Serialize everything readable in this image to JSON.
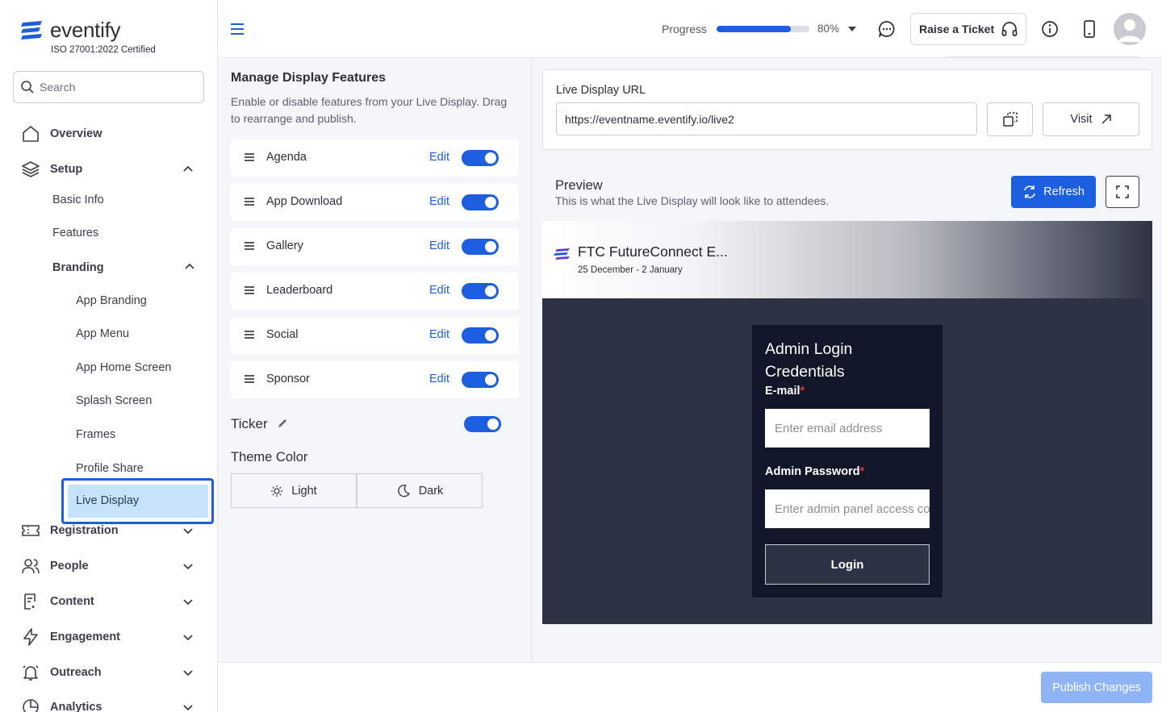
{
  "brand": {
    "name": "eventify",
    "certification": "ISO 27001:2022 Certified"
  },
  "search": {
    "placeholder": "Search"
  },
  "sidebar": {
    "overview": "Overview",
    "setup": "Setup",
    "setup_children": {
      "basic_info": "Basic Info",
      "features": "Features",
      "branding": "Branding",
      "branding_children": [
        "App Branding",
        "App Menu",
        "App Home Screen",
        "Splash Screen",
        "Frames",
        "Profile Share",
        "Live Display"
      ]
    },
    "registration": "Registration",
    "people": "People",
    "content": "Content",
    "engagement": "Engagement",
    "outreach": "Outreach",
    "analytics": "Analytics"
  },
  "topbar": {
    "progress_label": "Progress",
    "progress_percent": 80,
    "progress_text": "80%",
    "raise_ticket": "Raise a Ticket"
  },
  "features_panel": {
    "title": "Manage Display Features",
    "description": "Enable or disable features from your Live Display. Drag to rearrange and publish.",
    "edit_label": "Edit",
    "items": [
      {
        "name": "Agenda",
        "enabled": true
      },
      {
        "name": "App Download",
        "enabled": true
      },
      {
        "name": "Gallery",
        "enabled": true
      },
      {
        "name": "Leaderboard",
        "enabled": true
      },
      {
        "name": "Social",
        "enabled": true
      },
      {
        "name": "Sponsor",
        "enabled": true
      }
    ],
    "ticker_label": "Ticker",
    "ticker_enabled": true,
    "theme_label": "Theme Color",
    "theme_light": "Light",
    "theme_dark": "Dark"
  },
  "url_card": {
    "label": "Live Display URL",
    "url": "https://eventname.eventify.io/live2",
    "visit": "Visit"
  },
  "preview": {
    "title": "Preview",
    "description": "This is what the Live Display will look like to attendees.",
    "refresh": "Refresh",
    "event_title": "FTC FutureConnect E...",
    "event_dates": "25 December - 2 January",
    "login": {
      "title": "Admin Login Credentials",
      "email_label": "E-mail",
      "email_placeholder": "Enter email address",
      "password_label": "Admin Password",
      "password_placeholder": "Enter admin panel access code",
      "button": "Login",
      "required_mark": "*"
    }
  },
  "footer": {
    "publish": "Publish Changes"
  },
  "colors": {
    "accent": "#1b5fe0",
    "highlight": "#c5e4fb",
    "dark_preview": "#2d3244",
    "login_card": "#121629",
    "publish_disabled": "#8fb4f5"
  }
}
